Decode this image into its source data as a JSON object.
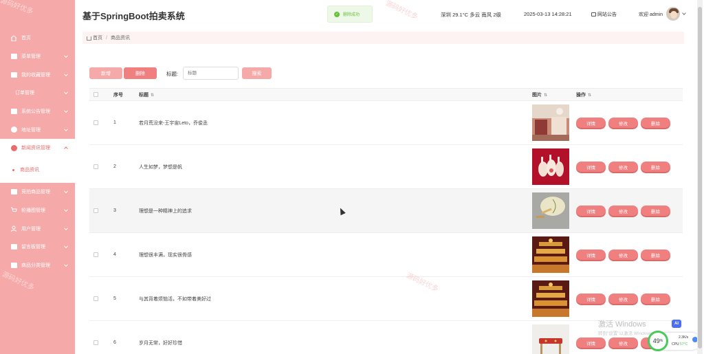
{
  "header": {
    "brand": "基于SpringBoot拍卖系统",
    "toast": "删除成功",
    "weather": "深圳 29.1°C 多云 南风 2级",
    "datetime": "2025-03-13 14:28:21",
    "notice": "网站公告",
    "welcome": "欢迎 admin"
  },
  "sidebar": {
    "watermark": "源码好优多",
    "items": [
      {
        "label": "首页",
        "icon": "home-icon"
      },
      {
        "label": "菜单管理",
        "icon": "menu-icon"
      },
      {
        "label": "我的收藏管理",
        "icon": "grid-icon"
      },
      {
        "label": "订单管理",
        "icon": ""
      },
      {
        "label": "系统公告管理",
        "icon": "grid-icon"
      },
      {
        "label": "地址管理",
        "icon": "box-icon"
      },
      {
        "label": "新闻资讯管理",
        "icon": "circle-icon"
      },
      {
        "label": "商品资讯",
        "icon": "dot-icon"
      },
      {
        "label": "竞拍商品管理",
        "icon": "grid-icon"
      },
      {
        "label": "轮播图管理",
        "icon": "cart-icon"
      },
      {
        "label": "用户管理",
        "icon": "user-icon"
      },
      {
        "label": "留言板管理",
        "icon": "grid-icon"
      },
      {
        "label": "商品分类管理",
        "icon": "box-icon"
      }
    ]
  },
  "breadcrumb": {
    "home": "首页",
    "current": "商品资讯"
  },
  "toolbar": {
    "add_label": "新增",
    "delete_label": "删除",
    "title_label": "标题:",
    "title_placeholder": "标题",
    "search_label": "搜索"
  },
  "table": {
    "headers": {
      "index": "序号",
      "title": "标题",
      "image": "图片",
      "ops": "操作"
    },
    "ops": {
      "detail": "详情",
      "edit": "修改",
      "delete": "删除"
    },
    "rows": [
      {
        "index": "1",
        "title": "若月荒没来-王宇宙Leto，乔俊丞"
      },
      {
        "index": "2",
        "title": "人生如梦，梦想是帆"
      },
      {
        "index": "3",
        "title": "理想是一种精神上的追求"
      },
      {
        "index": "4",
        "title": "理想很丰满，现实很骨感"
      },
      {
        "index": "5",
        "title": "与其背着烦恼活，不如带着美好过"
      },
      {
        "index": "6",
        "title": "岁月无常，好好珍惜"
      }
    ]
  },
  "overlay": {
    "watermark": "源码好优多",
    "win_title": "激活 Windows",
    "win_sub": "转到\"设置\"以激活 Windows。",
    "ai": "AI",
    "perf_value": "49",
    "perf_unit": "%",
    "net": "2.3K/s",
    "cpu_label": "CPU",
    "cpu_temp": "57°C"
  },
  "colors": {
    "sidebar": "#f6a9a9",
    "accent": "#f08080",
    "success": "#67c23a"
  }
}
